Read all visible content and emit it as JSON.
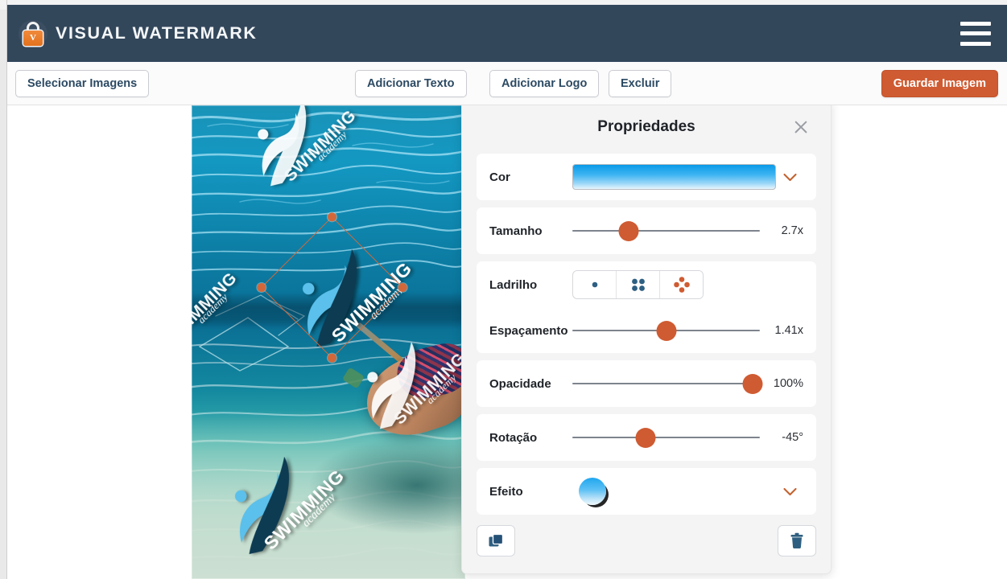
{
  "header": {
    "brand_name": "VISUAL WATERMARK",
    "logo_icon": "lock-icon",
    "logo_letter": "V",
    "menu_icon": "hamburger-menu-icon",
    "background_color": "#33475b"
  },
  "toolbar": {
    "select_images_label": "Selecionar Imagens",
    "add_text_label": "Adicionar Texto",
    "add_logo_label": "Adicionar Logo",
    "delete_label": "Excluir",
    "save_label": "Guardar Imagem",
    "save_color": "#cf5b32"
  },
  "canvas": {
    "watermark_text_primary": "SWIMMING",
    "watermark_text_secondary": "academy",
    "selection_handle_color": "#d2683a",
    "selection_rotation": "-45°"
  },
  "panel": {
    "title": "Propriedades",
    "close_icon": "close-icon",
    "rows": {
      "color": {
        "label": "Cor",
        "swatch_top_color": "#0a9ae8",
        "swatch_bottom_color": "#e9f6fd",
        "chevron_icon": "chevron-down-icon"
      },
      "size": {
        "label": "Tamanho",
        "value": "2.7x",
        "knob_percent": 30
      },
      "tile": {
        "label": "Ladrilho",
        "options": [
          {
            "name": "tile-single",
            "dots": 1,
            "selected": false
          },
          {
            "name": "tile-grid",
            "dots": 4,
            "selected": false
          },
          {
            "name": "tile-diamond",
            "dots": 5,
            "selected": true
          }
        ],
        "inactive_dot_color": "#2d5f82",
        "active_dot_color": "#cf5b32"
      },
      "spacing": {
        "label": "Espaçamento",
        "value": "1.41x",
        "knob_percent": 50
      },
      "opacity": {
        "label": "Opacidade",
        "value": "100%",
        "knob_percent": 96
      },
      "rotation": {
        "label": "Rotação",
        "value": "-45°",
        "knob_percent": 39
      },
      "effect": {
        "label": "Efeito",
        "preview": "blue-sphere-with-shadow",
        "chevron_icon": "chevron-down-icon"
      }
    },
    "actions": {
      "duplicate_icon": "duplicate-icon",
      "delete_icon": "trash-icon"
    }
  }
}
